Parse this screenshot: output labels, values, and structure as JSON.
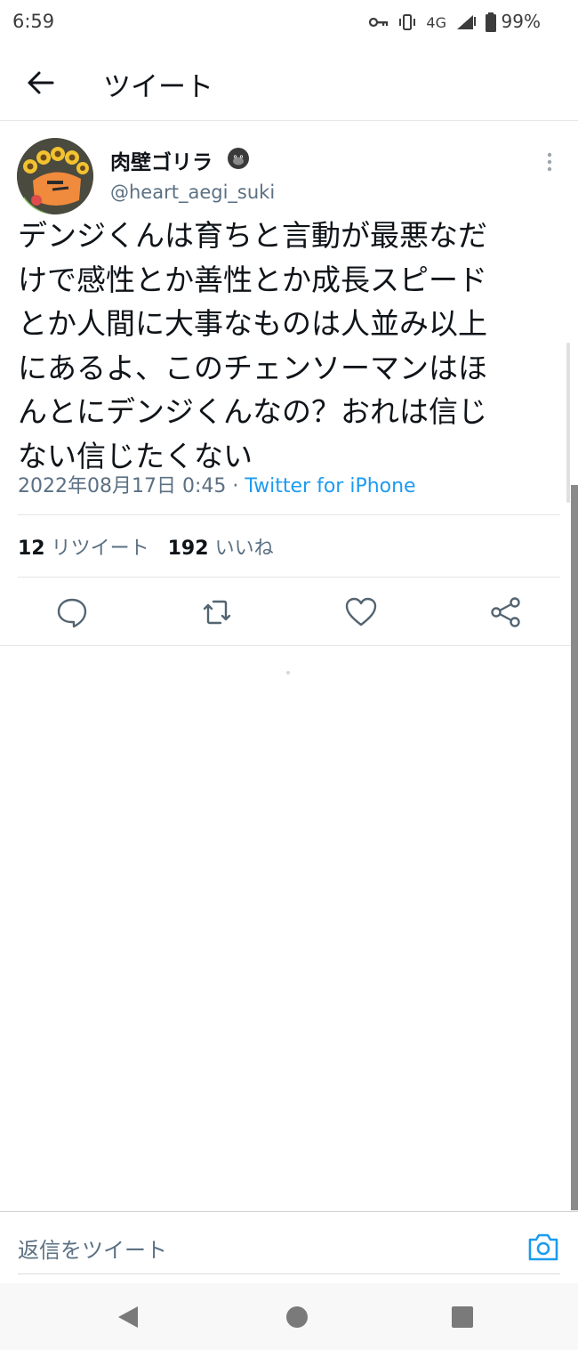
{
  "status_bar": {
    "time": "6:59",
    "network": "4G",
    "battery": "99%"
  },
  "header": {
    "title": "ツイート"
  },
  "tweet": {
    "display_name": "肉壁ゴリラ",
    "handle": "@heart_aegi_suki",
    "text": "デンジくんは育ちと言動が最悪なだ\nけで感性とか善性とか成長スピード\nとか人間に大事なものは人並み以上\nにあるよ、このチェンソーマンはほ\nんとにデンジくんなの？おれは信じ\nない信じたくない",
    "timestamp": "2022年08月17日 0:45",
    "separator": " · ",
    "source": "Twitter for iPhone",
    "retweet_count": "12",
    "retweet_label": "リツイート",
    "like_count": "192",
    "like_label": "いいね"
  },
  "reply": {
    "placeholder": "返信をツイート"
  },
  "colors": {
    "accent": "#1d9bf0",
    "secondary_text": "#5b7083",
    "icon": "#536471"
  },
  "icons": [
    "arrow-left",
    "more-vertical",
    "reply",
    "retweet",
    "heart",
    "share",
    "camera",
    "key",
    "vibrate",
    "signal",
    "battery",
    "gorilla-emoji"
  ]
}
